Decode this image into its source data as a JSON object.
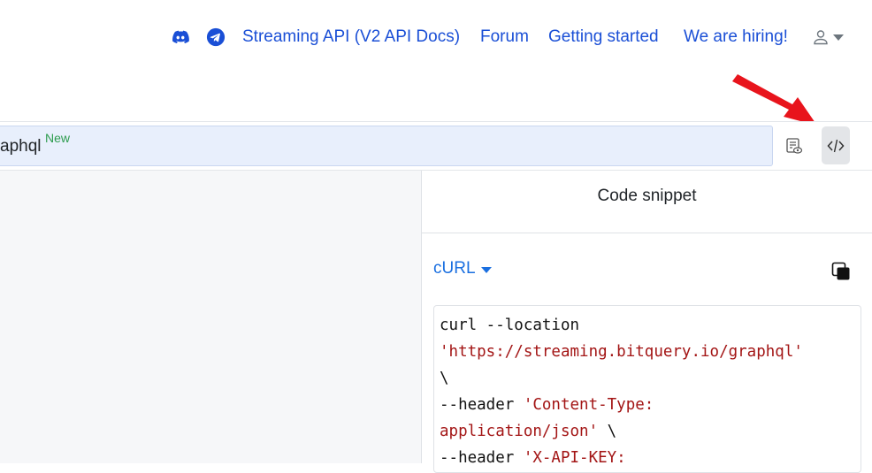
{
  "nav": {
    "discord_icon": "discord-icon",
    "telegram_icon": "telegram-icon",
    "links": [
      {
        "label": "Streaming API (V2 API Docs)"
      },
      {
        "label": "Forum"
      },
      {
        "label": "Getting started"
      },
      {
        "label": "We are hiring!"
      }
    ],
    "user_icon": "user-icon"
  },
  "toolbar": {
    "endpoint_text": "aphql",
    "endpoint_badge": "New",
    "buttons": [
      {
        "icon": "query-preview-icon",
        "active": false
      },
      {
        "icon": "code-icon",
        "active": true
      }
    ]
  },
  "code_panel": {
    "title": "Code snippet",
    "language": "cURL",
    "copy_icon": "copy-icon",
    "code_lines": [
      [
        {
          "t": "plain",
          "v": "curl --location"
        }
      ],
      [
        {
          "t": "str",
          "v": "'https://streaming.bitquery.io/graphql'"
        }
      ],
      [
        {
          "t": "plain",
          "v": "\\"
        }
      ],
      [
        {
          "t": "plain",
          "v": "--header "
        },
        {
          "t": "str",
          "v": "'Content-Type:"
        }
      ],
      [
        {
          "t": "str",
          "v": "application/json'"
        },
        {
          "t": "plain",
          "v": " \\"
        }
      ],
      [
        {
          "t": "plain",
          "v": "--header "
        },
        {
          "t": "str",
          "v": "'X-API-KEY:"
        }
      ]
    ]
  },
  "colors": {
    "link": "#1a4fd6",
    "accent": "#1a6fe0",
    "badge_green": "#2e9c4f",
    "string_red": "#a31515",
    "annotation_arrow": "#e8141c"
  }
}
